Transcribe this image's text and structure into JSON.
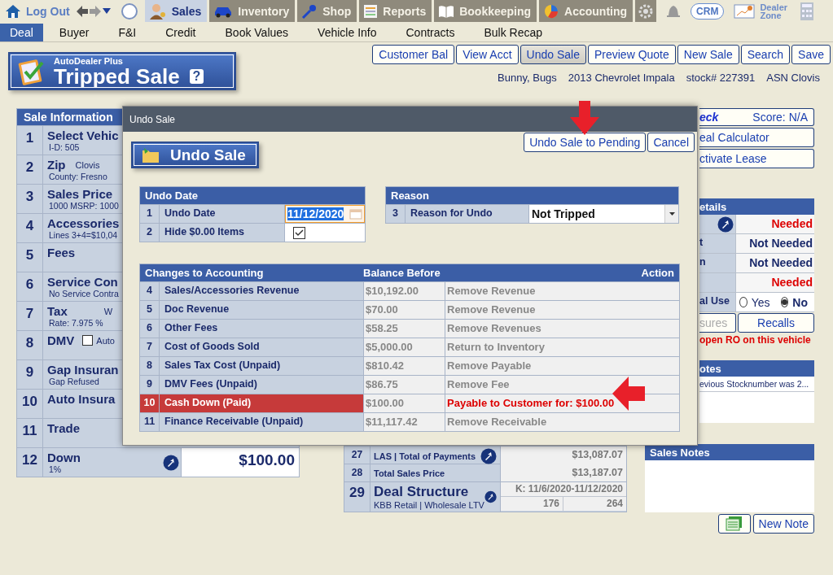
{
  "top_nav": {
    "logout": "Log Out",
    "modules": [
      {
        "label": "Sales",
        "selected": true
      },
      {
        "label": "Inventory",
        "selected": false
      },
      {
        "label": "Shop",
        "selected": false
      },
      {
        "label": "Reports",
        "selected": false
      },
      {
        "label": "Bookkeeping",
        "selected": false
      },
      {
        "label": "Accounting",
        "selected": false
      }
    ],
    "crm": "CRM",
    "dealer_zone": "Dealer Zone"
  },
  "sub_tabs": [
    {
      "label": "Deal",
      "selected": true
    },
    {
      "label": "Buyer",
      "selected": false
    },
    {
      "label": "F&I",
      "selected": false
    },
    {
      "label": "Credit",
      "selected": false
    },
    {
      "label": "Book Values",
      "selected": false
    },
    {
      "label": "Vehicle Info",
      "selected": false
    },
    {
      "label": "Contracts",
      "selected": false
    },
    {
      "label": "Bulk Recap",
      "selected": false
    }
  ],
  "title_badge": {
    "brand": "AutoDealer Plus",
    "title": "Tripped Sale",
    "help": "?"
  },
  "actions": [
    {
      "label": "Customer Bal",
      "selected": false
    },
    {
      "label": "View Acct",
      "selected": false
    },
    {
      "label": "Undo Sale",
      "selected": true
    },
    {
      "label": "Preview Quote",
      "selected": false
    },
    {
      "label": "New Sale",
      "selected": false
    },
    {
      "label": "Search",
      "selected": false
    },
    {
      "label": "Save",
      "selected": false
    }
  ],
  "deal_summary": [
    "Bunny,  Bugs",
    "2013 Chevrolet Impala",
    "stock# 227391",
    "ASN Clovis"
  ],
  "sale_information": {
    "title": "Sale Information",
    "rows": [
      {
        "number": "1",
        "label": "Select Vehic",
        "detail": "I-D:  505"
      },
      {
        "number": "2",
        "label": "Zip",
        "extra": "Clovis",
        "detail": "County: Fresno"
      },
      {
        "number": "3",
        "label": "Sales Price",
        "detail": "1000 MSRP: 1000"
      },
      {
        "number": "4",
        "label": "Accessories",
        "detail": "Lines 3+4=$10,04"
      },
      {
        "number": "5",
        "label": "Fees"
      },
      {
        "number": "6",
        "label": "Service Con",
        "detail": "No Service Contra"
      },
      {
        "number": "7",
        "label": "Tax",
        "extra": "W",
        "detail": "Rate: 7.975 %"
      },
      {
        "number": "8",
        "label": "DMV",
        "checked": false,
        "extra": "Auto"
      },
      {
        "number": "9",
        "label": "Gap Insuran",
        "detail": "Gap Refused"
      },
      {
        "number": "10",
        "label": "Auto Insura"
      },
      {
        "number": "11",
        "label": "Trade"
      },
      {
        "number": "12",
        "label": "Down",
        "detail": "1%",
        "value": "$100.00"
      }
    ]
  },
  "totals": {
    "rows": [
      {
        "number": "27",
        "label": "LAS | Total of Payments",
        "value": "$13,087.07"
      },
      {
        "number": "28",
        "label": "Total Sales Price",
        "value": "$13,187.07"
      },
      {
        "number": "29",
        "label": "Deal Structure",
        "detail": "KBB Retail | Wholesale LTV",
        "value": "K: 11/6/2020-11/12/2020",
        "values": [
          "176",
          "264"
        ]
      }
    ]
  },
  "right_panel": {
    "check": {
      "label": "eck",
      "score": "Score:  N/A"
    },
    "tools": [
      "eal Calculator",
      "ctivate Lease"
    ],
    "details": {
      "title": "etails",
      "rows": [
        {
          "status": "Needed",
          "needed": true
        },
        {
          "label": "t",
          "status": "Not Needed",
          "needed": false
        },
        {
          "label": "n",
          "status": "Not Needed",
          "needed": false
        },
        {
          "status": "Needed",
          "needed": true
        }
      ],
      "use": {
        "label": "al Use",
        "options": [
          {
            "label": "Yes",
            "selected": false
          },
          {
            "label": "No",
            "selected": true
          }
        ]
      }
    },
    "buttons": [
      {
        "label": "sures",
        "disabled": true
      },
      {
        "label": "Recalls",
        "disabled": false
      }
    ],
    "warning": "open RO on this vehicle",
    "notes": {
      "title": "otes",
      "items": [
        "evious Stocknumber was 2..."
      ]
    },
    "sales_notes": {
      "title": "Sales Notes"
    },
    "new_note": "New Note"
  },
  "dialog": {
    "title": "Undo Sale",
    "heading": "Undo Sale",
    "buttons": [
      "Undo Sale to Pending",
      "Cancel"
    ],
    "undo_date": {
      "title": "Undo Date",
      "rows": [
        {
          "number": "1",
          "label": "Undo Date",
          "kind": "date",
          "value": "11/12/2020"
        },
        {
          "number": "2",
          "label": "Hide $0.00 Items",
          "kind": "checkbox",
          "checked": true
        }
      ]
    },
    "reason": {
      "title": "Reason",
      "rows": [
        {
          "number": "3",
          "label": "Reason for Undo",
          "kind": "select",
          "value": "Not Tripped"
        }
      ]
    },
    "changes": {
      "columns": [
        "Changes to Accounting",
        "Balance Before",
        "Action"
      ],
      "rows": [
        {
          "number": "4",
          "account": "Sales/Accessories Revenue",
          "balance": "$10,192.00",
          "action": "Remove Revenue",
          "highlight": false
        },
        {
          "number": "5",
          "account": "Doc Revenue",
          "balance": "$70.00",
          "action": "Remove Revenue",
          "highlight": false
        },
        {
          "number": "6",
          "account": "Other Fees",
          "balance": "$58.25",
          "action": "Remove Revenues",
          "highlight": false
        },
        {
          "number": "7",
          "account": "Cost of Goods Sold",
          "balance": "$5,000.00",
          "action": "Return to Inventory",
          "highlight": false
        },
        {
          "number": "8",
          "account": "Sales Tax Cost (Unpaid)",
          "balance": "$810.42",
          "action": "Remove Payable",
          "highlight": false
        },
        {
          "number": "9",
          "account": "DMV Fees (Unpaid)",
          "balance": "$86.75",
          "action": "Remove Fee",
          "highlight": false
        },
        {
          "number": "10",
          "account": "Cash Down (Paid)",
          "balance": "$100.00",
          "action": "Payable to Customer for: $100.00",
          "highlight": true
        },
        {
          "number": "11",
          "account": "Finance Receivable (Unpaid)",
          "balance": "$11,117.42",
          "action": "Remove Receivable",
          "highlight": false
        }
      ]
    }
  }
}
